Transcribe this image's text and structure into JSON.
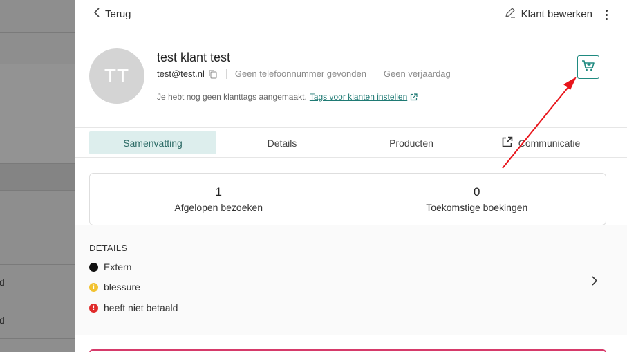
{
  "backdrop": {
    "row_fragments": [
      "d",
      "d"
    ]
  },
  "topbar": {
    "back_label": "Terug",
    "edit_label": "Klant bewerken"
  },
  "customer": {
    "initials": "TT",
    "name": "test klant test",
    "email": "test@test.nl",
    "phone": "Geen telefoonnummer gevonden",
    "birthday": "Geen verjaardag",
    "tags_text": "Je hebt nog geen klanttags aangemaakt.",
    "tags_link": "Tags voor klanten instellen"
  },
  "tabs": [
    {
      "label": "Samenvatting",
      "active": true
    },
    {
      "label": "Details",
      "active": false
    },
    {
      "label": "Producten",
      "active": false
    },
    {
      "label": "Communicatie",
      "active": false
    }
  ],
  "stats": [
    {
      "value": "1",
      "label": "Afgelopen bezoeken"
    },
    {
      "value": "0",
      "label": "Toekomstige boekingen"
    }
  ],
  "details": {
    "heading": "DETAILS",
    "items": [
      {
        "label": "Extern",
        "color": "#111111",
        "icon": "black-circle-icon"
      },
      {
        "label": "blessure",
        "color": "#f2c230",
        "icon": "info-circle-icon"
      },
      {
        "label": "heeft niet betaald",
        "color": "#e02b2b",
        "icon": "alert-circle-icon"
      }
    ]
  },
  "colors": {
    "accent": "#1f8a80",
    "active_tab_bg": "#ddeeed",
    "annotation_arrow": "#e8151b"
  }
}
